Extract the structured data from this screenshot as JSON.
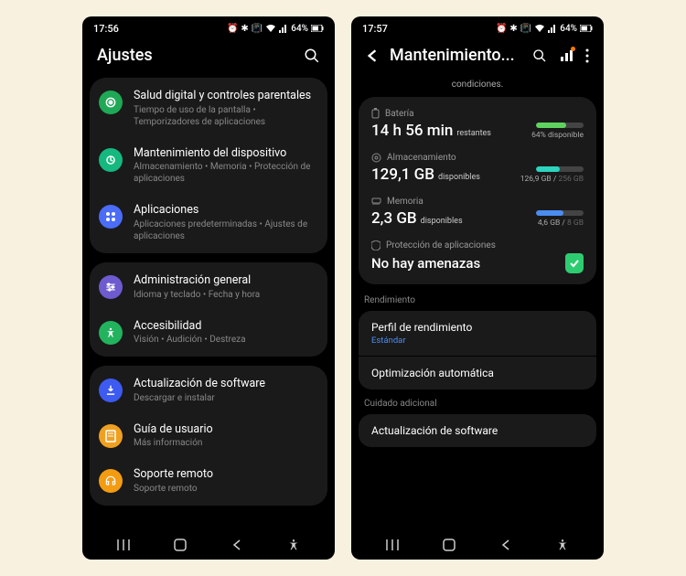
{
  "phone1": {
    "status": {
      "time": "17:56",
      "battery_text": "64%"
    },
    "header": {
      "title": "Ajustes"
    },
    "groups": [
      {
        "items": [
          {
            "title": "Salud digital y controles parentales",
            "sub": "Tiempo de uso de la pantalla  •  Temporizadores de aplicaciones"
          },
          {
            "title": "Mantenimiento del dispositivo",
            "sub": "Almacenamiento  •  Memoria  •  Protección de aplicaciones"
          },
          {
            "title": "Aplicaciones",
            "sub": "Aplicaciones predeterminadas  •  Ajustes de aplicaciones"
          }
        ]
      },
      {
        "items": [
          {
            "title": "Administración general",
            "sub": "Idioma y teclado  •  Fecha y hora"
          },
          {
            "title": "Accesibilidad",
            "sub": "Visión  •  Audición  •  Destreza"
          }
        ]
      },
      {
        "items": [
          {
            "title": "Actualización de software",
            "sub": "Descargar e instalar"
          },
          {
            "title": "Guía de usuario",
            "sub": "Más información"
          },
          {
            "title": "Soporte remoto",
            "sub": "Soporte remoto"
          }
        ]
      }
    ]
  },
  "phone2": {
    "status": {
      "time": "17:57",
      "battery_text": "64%"
    },
    "header": {
      "title": "Mantenimiento..."
    },
    "subtext": "condiciones.",
    "metrics": {
      "battery": {
        "label": "Batería",
        "value": "14 h 56 min",
        "unit": "restantes",
        "right": "64% disponible",
        "fill_pct": 64,
        "color": "#5fd35f"
      },
      "storage": {
        "label": "Almacenamiento",
        "value": "129,1 GB",
        "unit": "disponibles",
        "right_used": "126,9 GB",
        "right_total": "256 GB",
        "fill_pct": 50,
        "color": "#2dd4bf"
      },
      "memory": {
        "label": "Memoria",
        "value": "2,3 GB",
        "unit": "disponibles",
        "right_used": "4,6 GB",
        "right_total": "8 GB",
        "fill_pct": 58,
        "color": "#4a8cf0"
      },
      "protection": {
        "label": "Protección de aplicaciones",
        "value": "No hay amenazas"
      }
    },
    "perf_section": "Rendimiento",
    "perf_profile": {
      "title": "Perfil de rendimiento",
      "sub": "Estándar"
    },
    "auto_opt": {
      "title": "Optimización automática"
    },
    "care_section": "Cuidado adicional",
    "sw_update": {
      "title": "Actualización de software"
    }
  }
}
